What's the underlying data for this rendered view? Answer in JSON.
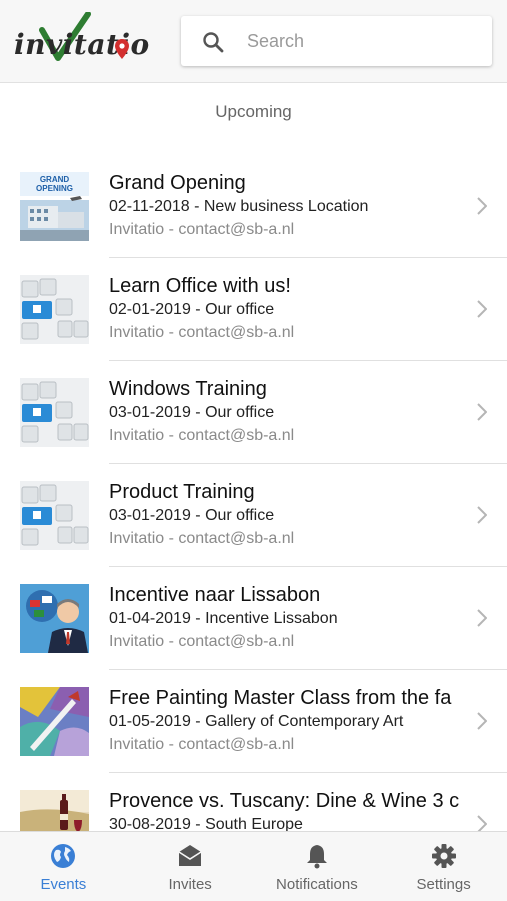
{
  "app": {
    "logo_text": "invitatio",
    "search": {
      "placeholder": "Search",
      "value": ""
    }
  },
  "section_title": "Upcoming",
  "events": [
    {
      "title": "Grand Opening",
      "subtitle": "02-11-2018 - New business Location",
      "organizer": "Invitatio - contact@sb-a.nl",
      "thumb": "grand-opening",
      "thumb_text": "GRAND OPENING"
    },
    {
      "title": "Learn Office with us!",
      "subtitle": "02-01-2019 - Our office",
      "organizer": "Invitatio - contact@sb-a.nl",
      "thumb": "keyboard"
    },
    {
      "title": "Windows Training",
      "subtitle": "03-01-2019 - Our office",
      "organizer": "Invitatio - contact@sb-a.nl",
      "thumb": "keyboard"
    },
    {
      "title": "Product Training",
      "subtitle": "03-01-2019 - Our office",
      "organizer": "Invitatio - contact@sb-a.nl",
      "thumb": "keyboard"
    },
    {
      "title": "Incentive naar Lissabon",
      "subtitle": "01-04-2019 - Incentive Lissabon",
      "organizer": "Invitatio - contact@sb-a.nl",
      "thumb": "person-flags"
    },
    {
      "title": "Free Painting Master Class from the fa",
      "subtitle": "01-05-2019 - Gallery of Contemporary Art",
      "organizer": "Invitatio - contact@sb-a.nl",
      "thumb": "painting"
    },
    {
      "title": "Provence vs. Tuscany: Dine & Wine 3 c",
      "subtitle": "30-08-2019 - South Europe",
      "organizer": "",
      "thumb": "wine"
    }
  ],
  "nav": {
    "items": [
      {
        "label": "Events",
        "icon": "globe-icon",
        "active": true
      },
      {
        "label": "Invites",
        "icon": "envelope-icon",
        "active": false
      },
      {
        "label": "Notifications",
        "icon": "bell-icon",
        "active": false
      },
      {
        "label": "Settings",
        "icon": "gear-icon",
        "active": false
      }
    ]
  },
  "colors": {
    "accent": "#3a7fd5",
    "logo_check": "#2e7d32",
    "logo_pin": "#d32f2f",
    "divider": "#e0e0e0"
  }
}
